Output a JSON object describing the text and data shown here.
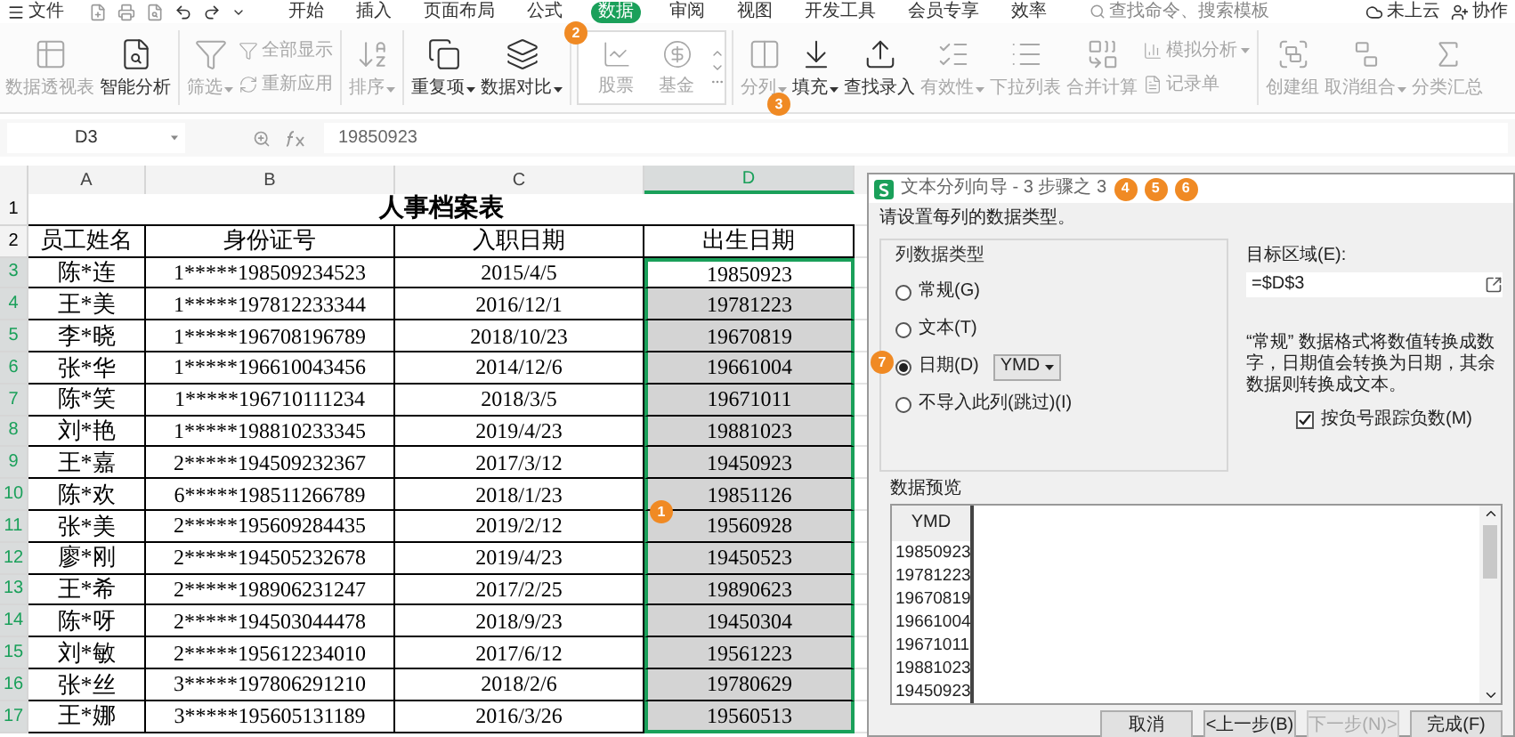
{
  "menu": {
    "file": "文件",
    "tabs": [
      {
        "label": "开始",
        "selected": false
      },
      {
        "label": "插入",
        "selected": false
      },
      {
        "label": "页面布局",
        "selected": false
      },
      {
        "label": "公式",
        "selected": false
      },
      {
        "label": "数据",
        "selected": true
      },
      {
        "label": "审阅",
        "selected": false
      },
      {
        "label": "视图",
        "selected": false
      },
      {
        "label": "开发工具",
        "selected": false
      },
      {
        "label": "会员专享",
        "selected": false
      },
      {
        "label": "效率",
        "selected": false
      }
    ],
    "search": {
      "placeholder": "查找命令、搜索模板"
    },
    "actions": [
      "未上云",
      "协作"
    ]
  },
  "ribbon": {
    "groups": [
      {
        "items": [
          {
            "kind": "large",
            "label": "数据透视表",
            "disabled": true,
            "dropdown": false
          },
          {
            "kind": "large",
            "label": "智能分析",
            "disabled": false,
            "dropdown": false
          }
        ]
      },
      {
        "items": [
          {
            "kind": "large",
            "label": "筛选",
            "disabled": true,
            "dropdown": true
          },
          {
            "kind": "stack",
            "items": [
              {
                "label": "全部显示",
                "disabled": true,
                "dropdown": false
              },
              {
                "label": "重新应用",
                "disabled": true,
                "dropdown": false
              }
            ]
          }
        ]
      },
      {
        "items": [
          {
            "kind": "large",
            "label": "排序",
            "disabled": true,
            "dropdown": true
          }
        ]
      },
      {
        "items": [
          {
            "kind": "large",
            "label": "重复项",
            "disabled": false,
            "dropdown": true
          },
          {
            "kind": "large",
            "label": "数据对比",
            "disabled": false,
            "dropdown": true
          }
        ]
      },
      {
        "items": [
          {
            "kind": "gallery",
            "items": [
              {
                "label": "股票",
                "disabled": true
              },
              {
                "label": "基金",
                "disabled": true
              }
            ]
          }
        ]
      },
      {
        "items": [
          {
            "kind": "large",
            "label": "分列",
            "disabled": true,
            "dropdown": true
          },
          {
            "kind": "large",
            "label": "填充",
            "disabled": false,
            "dropdown": true
          },
          {
            "kind": "large",
            "label": "查找录入",
            "disabled": false,
            "dropdown": false
          },
          {
            "kind": "large",
            "label": "有效性",
            "disabled": true,
            "dropdown": true
          },
          {
            "kind": "large",
            "label": "下拉列表",
            "disabled": true,
            "dropdown": false
          },
          {
            "kind": "large",
            "label": "合并计算",
            "disabled": true,
            "dropdown": false
          },
          {
            "kind": "stack",
            "items": [
              {
                "label": "模拟分析",
                "disabled": true,
                "dropdown": true
              },
              {
                "label": "记录单",
                "disabled": true,
                "dropdown": false
              }
            ]
          }
        ]
      },
      {
        "items": [
          {
            "kind": "large",
            "label": "创建组",
            "disabled": true,
            "dropdown": false
          },
          {
            "kind": "large",
            "label": "取消组合",
            "disabled": true,
            "dropdown": true
          },
          {
            "kind": "large",
            "label": "分类汇总",
            "disabled": true,
            "dropdown": false
          }
        ]
      }
    ]
  },
  "formula_bar": {
    "cell": "D3",
    "value": "19850923"
  },
  "sheet": {
    "columns": [
      {
        "label": "A",
        "selected": false
      },
      {
        "label": "B",
        "selected": false
      },
      {
        "label": "C",
        "selected": false
      },
      {
        "label": "D",
        "selected": true
      }
    ],
    "title_row": {
      "number": "1",
      "text": "人事档案表"
    },
    "header_row": {
      "number": "2",
      "cells": [
        "员工姓名",
        "身份证号",
        "入职日期",
        "出生日期"
      ]
    },
    "rows": [
      {
        "number": "3",
        "selected": true,
        "active": true,
        "cells": [
          "陈*连",
          "1*****198509234523",
          "2015/4/5",
          "19850923"
        ]
      },
      {
        "number": "4",
        "selected": true,
        "active": false,
        "cells": [
          "王*美",
          "1*****197812233344",
          "2016/12/1",
          "19781223"
        ]
      },
      {
        "number": "5",
        "selected": true,
        "active": false,
        "cells": [
          "李*晓",
          "1*****196708196789",
          "2018/10/23",
          "19670819"
        ]
      },
      {
        "number": "6",
        "selected": true,
        "active": false,
        "cells": [
          "张*华",
          "1*****196610043456",
          "2014/12/6",
          "19661004"
        ]
      },
      {
        "number": "7",
        "selected": true,
        "active": false,
        "cells": [
          "陈*笑",
          "1*****196710111234",
          "2018/3/5",
          "19671011"
        ]
      },
      {
        "number": "8",
        "selected": true,
        "active": false,
        "cells": [
          "刘*艳",
          "1*****198810233345",
          "2019/4/23",
          "19881023"
        ]
      },
      {
        "number": "9",
        "selected": true,
        "active": false,
        "cells": [
          "王*嘉",
          "2*****194509232367",
          "2017/3/12",
          "19450923"
        ]
      },
      {
        "number": "10",
        "selected": true,
        "active": false,
        "cells": [
          "陈*欢",
          "6*****198511266789",
          "2018/1/23",
          "19851126"
        ]
      },
      {
        "number": "11",
        "selected": true,
        "active": false,
        "cells": [
          "张*美",
          "2*****195609284435",
          "2019/2/12",
          "19560928"
        ]
      },
      {
        "number": "12",
        "selected": true,
        "active": false,
        "cells": [
          "廖*刚",
          "2*****194505232678",
          "2019/4/23",
          "19450523"
        ]
      },
      {
        "number": "13",
        "selected": true,
        "active": false,
        "cells": [
          "王*希",
          "2*****198906231247",
          "2017/2/25",
          "19890623"
        ]
      },
      {
        "number": "14",
        "selected": true,
        "active": false,
        "cells": [
          "陈*呀",
          "2*****194503044478",
          "2018/9/23",
          "19450304"
        ]
      },
      {
        "number": "15",
        "selected": true,
        "active": false,
        "cells": [
          "刘*敏",
          "2*****195612234010",
          "2017/6/12",
          "19561223"
        ]
      },
      {
        "number": "16",
        "selected": true,
        "active": false,
        "cells": [
          "张*丝",
          "3*****197806291210",
          "2018/2/6",
          "19780629"
        ]
      },
      {
        "number": "17",
        "selected": true,
        "active": false,
        "cells": [
          "王*娜",
          "3*****195605131189",
          "2016/3/26",
          "19560513"
        ]
      }
    ]
  },
  "dialog": {
    "title": "文本分列向导 - 3 步骤之 3",
    "instruction": "请设置每列的数据类型。",
    "group_label": "列数据类型",
    "options": [
      {
        "label": "常规(G)",
        "selected": false
      },
      {
        "label": "文本(T)",
        "selected": false
      },
      {
        "label": "日期(D)",
        "selected": true,
        "format": "YMD"
      },
      {
        "label": "不导入此列(跳过)(I)",
        "selected": false
      }
    ],
    "target": {
      "label": "目标区域(E):",
      "value": "=$D$3"
    },
    "description": "“常规” 数据格式将数值转换成数字，日期值会转换为日期，其余数据则转换成文本。",
    "checkbox": {
      "label": "按负号跟踪负数(M)",
      "checked": true
    },
    "preview": {
      "label": "数据预览",
      "header": "YMD",
      "values": [
        "19850923",
        "19781223",
        "19670819",
        "19661004",
        "19671011",
        "19881023",
        "19450923"
      ]
    },
    "buttons": [
      {
        "label": "取消",
        "disabled": false
      },
      {
        "label": "<上一步(B)",
        "disabled": false
      },
      {
        "label": "下一步(N)>",
        "disabled": true
      },
      {
        "label": "完成(F)",
        "disabled": false
      }
    ]
  },
  "callouts": [
    "1",
    "2",
    "3",
    "4",
    "5",
    "6",
    "7"
  ]
}
